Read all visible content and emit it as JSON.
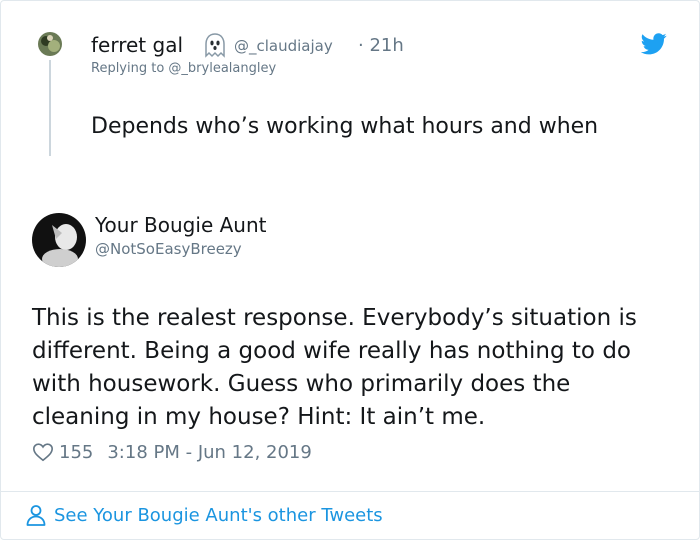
{
  "reply_tweet": {
    "display_name": "ferret gal",
    "handle": "@_claudiajay",
    "time": "· 21h",
    "replying_to": "Replying to @_brylealangley",
    "text": "Depends who’s working what hours and when",
    "name_emoji_icon": "ghost-icon"
  },
  "main_tweet": {
    "display_name": "Your Bougie Aunt",
    "handle": "@NotSoEasyBreezy",
    "text_lines": [
      "This is the realest response. Everybody’s situation is",
      "different. Being a good wife really has nothing to do",
      "with housework. Guess who primarily does the",
      "cleaning in my house? Hint: It ain’t me."
    ],
    "likes": "155",
    "timestamp": "3:18 PM - Jun 12, 2019"
  },
  "footer": {
    "see_more": "See Your Bougie Aunt's other Tweets"
  },
  "colors": {
    "link_blue": "#1b95e0",
    "twitter_blue": "#1da1f2",
    "secondary_text": "#657786",
    "primary_text": "#14171a",
    "border": "#e1e8ed"
  },
  "icons": [
    "twitter-bird-icon",
    "heart-icon",
    "person-icon",
    "ghost-icon"
  ]
}
